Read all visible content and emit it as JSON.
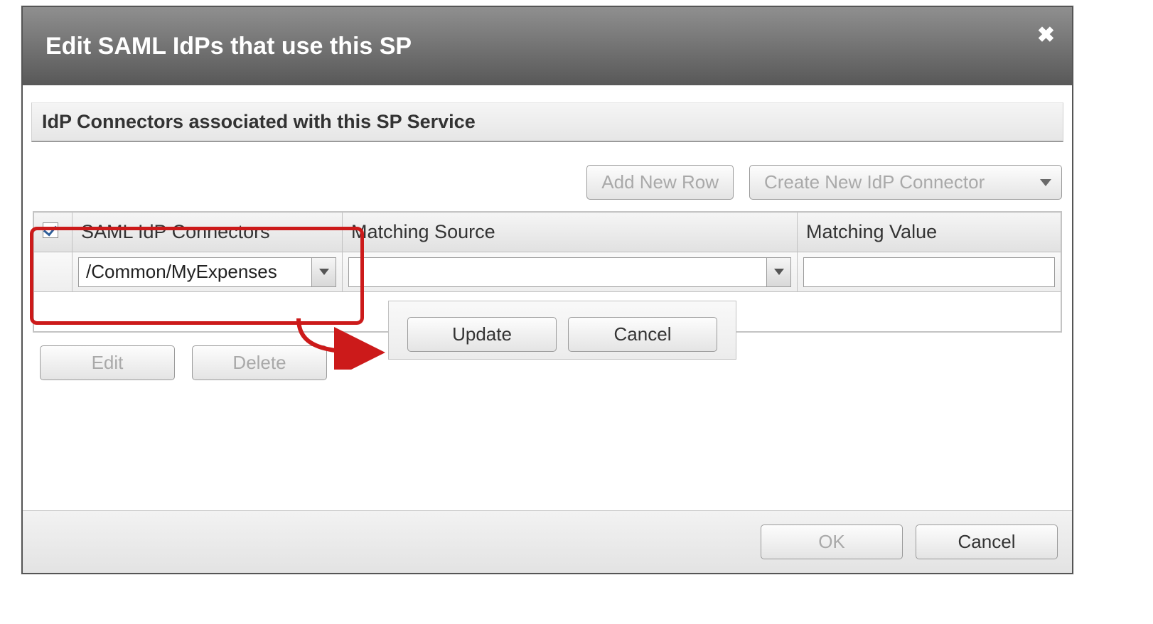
{
  "dialog": {
    "title": "Edit SAML IdPs that use this SP",
    "close": "✖"
  },
  "section": {
    "title": "IdP Connectors associated with this SP Service"
  },
  "toolbar": {
    "add_row": "Add New Row",
    "create_connector": "Create New IdP Connector"
  },
  "columns": {
    "connectors": "SAML IdP Connectors",
    "source": "Matching Source",
    "value": "Matching Value"
  },
  "row": {
    "connector_value": "/Common/MyExpenses",
    "source_value": "",
    "value_value": ""
  },
  "inner_actions": {
    "update": "Update",
    "cancel": "Cancel"
  },
  "bottom_actions": {
    "edit": "Edit",
    "delete": "Delete"
  },
  "footer": {
    "ok": "OK",
    "cancel": "Cancel"
  }
}
